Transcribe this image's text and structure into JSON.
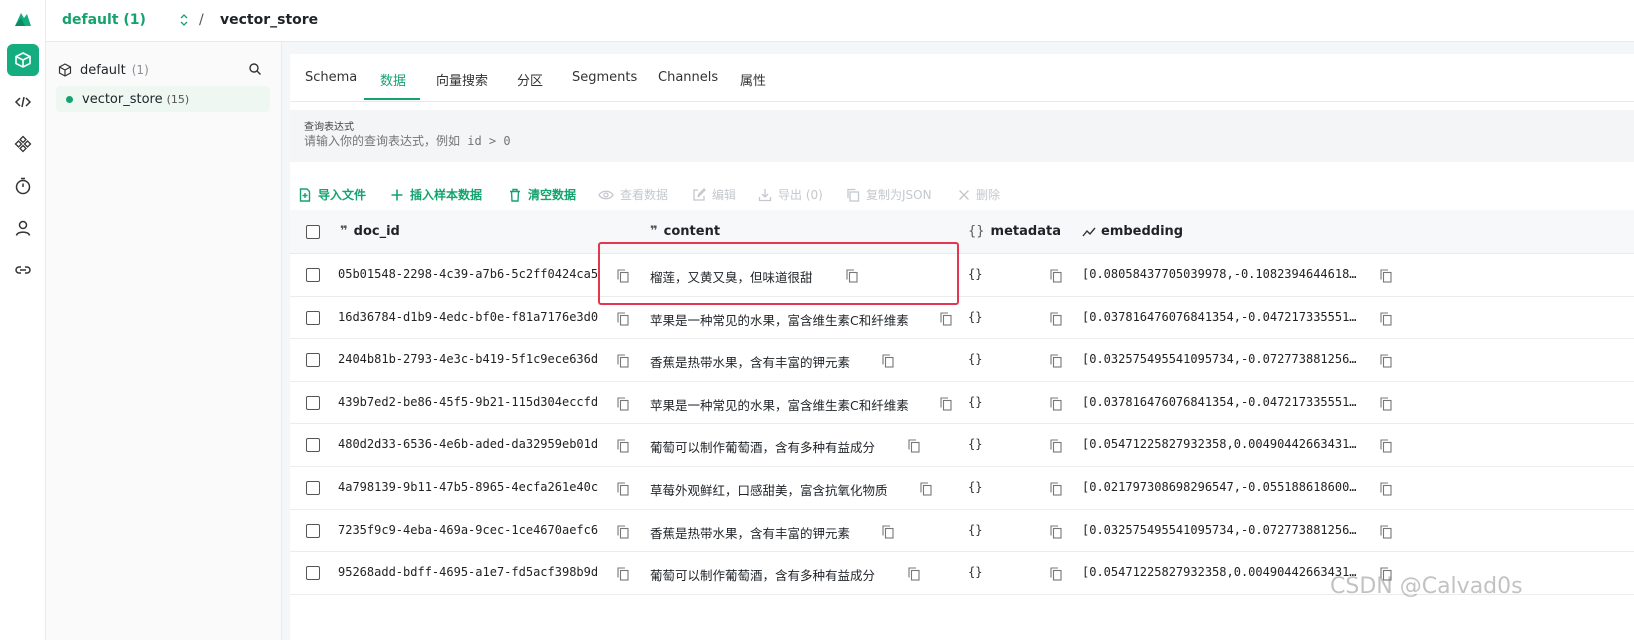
{
  "breadcrumb": {
    "database": "default (1)",
    "separator": "/",
    "collection": "vector_store"
  },
  "rail": {
    "icons": [
      "milvus-logo-icon",
      "collection-icon",
      "code-icon",
      "partition-icon",
      "timer-icon",
      "user-icon",
      "link-icon"
    ]
  },
  "tree": {
    "db_name": "default",
    "db_count": "(1)",
    "collection_name": "vector_store",
    "collection_count": "(15)"
  },
  "tabs": [
    "Schema",
    "数据",
    "向量搜索",
    "分区",
    "Segments",
    "Channels",
    "属性"
  ],
  "active_tab": "数据",
  "query": {
    "label": "查询表达式",
    "placeholder": "请输入你的查询表达式，例如 id > 0"
  },
  "toolbar": {
    "import": "导入文件",
    "insert_sample": "插入样本数据",
    "clear": "清空数据",
    "view": "查看数据",
    "edit": "编辑",
    "export": "导出 (0)",
    "copy_json": "复制为JSON",
    "delete": "删除"
  },
  "columns": {
    "doc_id": "doc_id",
    "content": "content",
    "metadata": "metadata",
    "embedding": "embedding"
  },
  "rows": [
    {
      "doc_id": "05b01548-2298-4c39-a7b6-5c2ff0424ca5",
      "content": "榴莲，又黄又臭，但味道很甜",
      "metadata": "{}",
      "embedding": "[0.08058437705039978,-0.1082394644618…"
    },
    {
      "doc_id": "16d36784-d1b9-4edc-bf0e-f81a7176e3d0",
      "content": "苹果是一种常见的水果，富含维生素C和纤维素",
      "metadata": "{}",
      "embedding": "[0.037816476076841354,-0.047217335551…"
    },
    {
      "doc_id": "2404b81b-2793-4e3c-b419-5f1c9ece636d",
      "content": "香蕉是热带水果，含有丰富的钾元素",
      "metadata": "{}",
      "embedding": "[0.032575495541095734,-0.072773881256…"
    },
    {
      "doc_id": "439b7ed2-be86-45f5-9b21-115d304eccfd",
      "content": "苹果是一种常见的水果，富含维生素C和纤维素",
      "metadata": "{}",
      "embedding": "[0.037816476076841354,-0.047217335551…"
    },
    {
      "doc_id": "480d2d33-6536-4e6b-aded-da32959eb01d",
      "content": "葡萄可以制作葡萄酒，含有多种有益成分",
      "metadata": "{}",
      "embedding": "[0.05471225827932358,0.00490442663431…"
    },
    {
      "doc_id": "4a798139-9b11-47b5-8965-4ecfa261e40c",
      "content": "草莓外观鲜红，口感甜美，富含抗氧化物质",
      "metadata": "{}",
      "embedding": "[0.021797308698296547,-0.055188618600…"
    },
    {
      "doc_id": "7235f9c9-4eba-469a-9cec-1ce4670aefc6",
      "content": "香蕉是热带水果，含有丰富的钾元素",
      "metadata": "{}",
      "embedding": "[0.032575495541095734,-0.072773881256…"
    },
    {
      "doc_id": "95268add-bdff-4695-a1e7-fd5acf398b9d",
      "content": "葡萄可以制作葡萄酒，含有多种有益成分",
      "metadata": "{}",
      "embedding": "[0.05471225827932358,0.00490442663431…"
    }
  ],
  "watermark": "CSDN @Calvad0s",
  "colors": {
    "accent": "#14a36f",
    "highlight": "#e5364f"
  }
}
